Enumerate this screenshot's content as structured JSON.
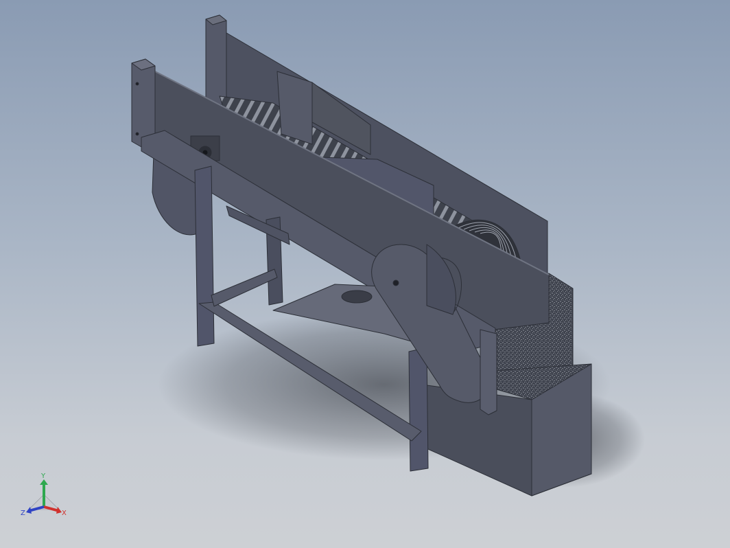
{
  "view": {
    "background_top": "#8a9bb3",
    "background_bottom": "#cdd0d4",
    "model_color": "#4b4f5c"
  },
  "triad": {
    "x_label": "X",
    "y_label": "Y",
    "z_label": "Z",
    "x_color": "#d0312d",
    "y_color": "#2fa84f",
    "z_color": "#2f43c4"
  }
}
